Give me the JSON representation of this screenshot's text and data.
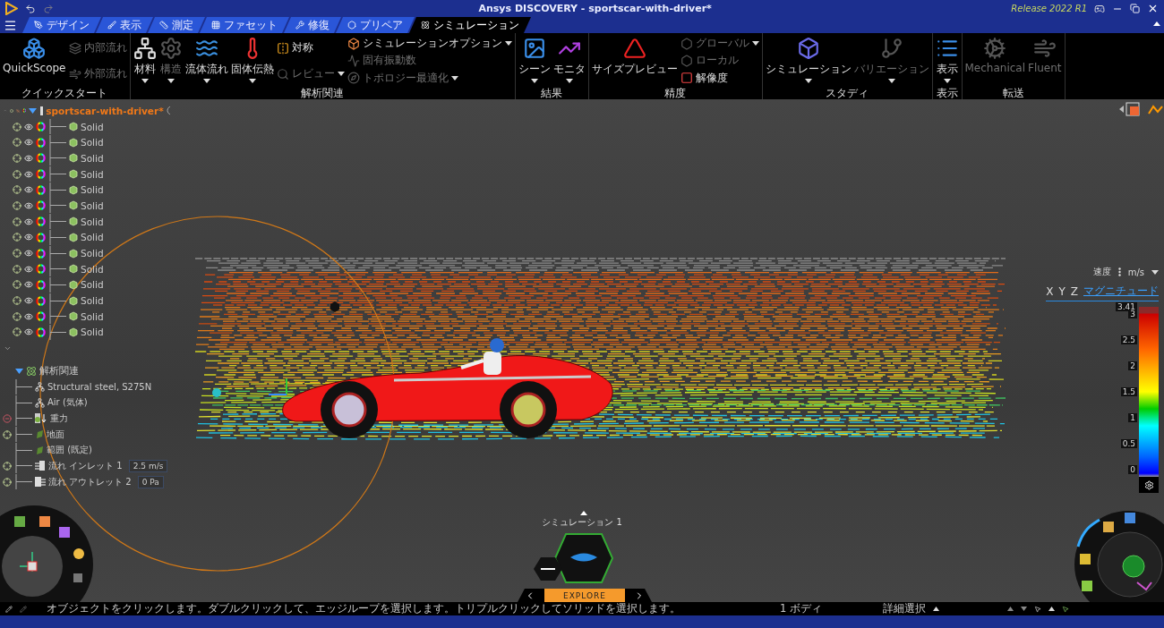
{
  "window": {
    "title": "Ansys DISCOVERY - sportscar-with-driver*",
    "release": "Release 2022 R1"
  },
  "tabs": [
    {
      "label": "デザイン",
      "selected": false
    },
    {
      "label": "表示",
      "selected": false
    },
    {
      "label": "測定",
      "selected": false
    },
    {
      "label": "ファセット",
      "selected": false
    },
    {
      "label": "修復",
      "selected": false
    },
    {
      "label": "プリペア",
      "selected": false
    },
    {
      "label": "シミュレーション",
      "selected": true
    }
  ],
  "ribbon": {
    "groups": [
      {
        "label": "クイックスタート",
        "columns": [
          {
            "items": [
              {
                "label": "QuickScope",
                "kind": "large",
                "disabled": false,
                "dropdown": false
              }
            ]
          },
          {
            "items": [
              {
                "label": "内部流れ",
                "kind": "small",
                "disabled": true,
                "dropdown": false
              },
              {
                "label": "外部流れ",
                "kind": "small",
                "disabled": true,
                "dropdown": false
              }
            ]
          }
        ]
      },
      {
        "label": "解析関連",
        "columns": [
          {
            "items": [
              {
                "label": "材料",
                "kind": "large",
                "disabled": false,
                "dropdown": true
              }
            ]
          },
          {
            "items": [
              {
                "label": "構造",
                "kind": "large",
                "disabled": true,
                "dropdown": true
              }
            ]
          },
          {
            "items": [
              {
                "label": "流体流れ",
                "kind": "large",
                "disabled": false,
                "dropdown": true
              }
            ]
          },
          {
            "items": [
              {
                "label": "固体伝熱",
                "kind": "large",
                "disabled": false,
                "dropdown": true
              }
            ]
          },
          {
            "items": [
              {
                "label": "対称",
                "kind": "small",
                "disabled": false,
                "dropdown": false
              },
              {
                "label": "レビュー",
                "kind": "small",
                "disabled": true,
                "dropdown": true
              }
            ]
          },
          {
            "items": [
              {
                "label": "シミュレーションオプション",
                "kind": "small",
                "disabled": false,
                "dropdown": true
              },
              {
                "label": "固有振動数",
                "kind": "small",
                "disabled": true,
                "dropdown": false
              },
              {
                "label": "トポロジー最適化",
                "kind": "small",
                "disabled": true,
                "dropdown": true
              }
            ]
          }
        ]
      },
      {
        "label": "結果",
        "columns": [
          {
            "items": [
              {
                "label": "シーン",
                "kind": "large",
                "disabled": false,
                "dropdown": true
              }
            ]
          },
          {
            "items": [
              {
                "label": "モニタ",
                "kind": "large",
                "disabled": false,
                "dropdown": true
              }
            ]
          }
        ]
      },
      {
        "label": "精度",
        "columns": [
          {
            "items": [
              {
                "label": "サイズプレビュー",
                "kind": "large",
                "disabled": false,
                "dropdown": false
              }
            ]
          },
          {
            "items": [
              {
                "label": "グローバル",
                "kind": "small",
                "disabled": true,
                "dropdown": true
              },
              {
                "label": "ローカル",
                "kind": "small",
                "disabled": true,
                "dropdown": false
              },
              {
                "label": "解像度",
                "kind": "small",
                "disabled": false,
                "dropdown": false
              }
            ]
          }
        ]
      },
      {
        "label": "スタディ",
        "columns": [
          {
            "items": [
              {
                "label": "シミュレーション",
                "kind": "large",
                "disabled": false,
                "dropdown": true
              }
            ]
          },
          {
            "items": [
              {
                "label": "バリエーション",
                "kind": "large",
                "disabled": true,
                "dropdown": true
              }
            ]
          }
        ]
      },
      {
        "label": "表示",
        "columns": [
          {
            "items": [
              {
                "label": "表示",
                "kind": "large",
                "disabled": false,
                "dropdown": true
              }
            ]
          }
        ]
      },
      {
        "label": "転送",
        "columns": [
          {
            "items": [
              {
                "label": "Mechanical",
                "kind": "large",
                "disabled": true,
                "dropdown": false
              }
            ]
          },
          {
            "items": [
              {
                "label": "Fluent",
                "kind": "large",
                "disabled": true,
                "dropdown": false
              }
            ]
          }
        ]
      }
    ]
  },
  "structure_tree": {
    "label": "sportscar-with-driver*",
    "expanded": true,
    "children": [
      {
        "label": "Solid"
      },
      {
        "label": "Solid"
      },
      {
        "label": "Solid"
      },
      {
        "label": "Solid"
      },
      {
        "label": "Solid"
      },
      {
        "label": "Solid"
      },
      {
        "label": "Solid"
      },
      {
        "label": "Solid"
      },
      {
        "label": "Solid"
      },
      {
        "label": "Solid"
      },
      {
        "label": "Solid"
      },
      {
        "label": "Solid"
      },
      {
        "label": "Solid"
      },
      {
        "label": "Solid"
      }
    ]
  },
  "analysis_tree": {
    "label": "解析関連",
    "expanded": true,
    "children": [
      {
        "label": "Structural steel, S275N",
        "kind": "material",
        "target": false
      },
      {
        "label": "Air (気体)",
        "kind": "material",
        "target": false
      },
      {
        "label": "重力",
        "kind": "gravity",
        "target": true,
        "suppressed": true
      },
      {
        "label": "地面",
        "kind": "surface",
        "target": true,
        "suppressed": false
      },
      {
        "label": "範囲 (既定)",
        "kind": "surface",
        "target": false
      },
      {
        "label": "流れ インレット 1",
        "kind": "inlet",
        "target": true,
        "suppressed": false,
        "value": "2.5 m/s"
      },
      {
        "label": "流れ アウトレット 2",
        "kind": "outlet",
        "target": true,
        "suppressed": false,
        "value": "0 Pa"
      }
    ]
  },
  "legend": {
    "quantity": "速度",
    "unit": "m/s",
    "components": [
      {
        "label": "X",
        "selected": false
      },
      {
        "label": "Y",
        "selected": false
      },
      {
        "label": "Z",
        "selected": false
      },
      {
        "label": "マグニチュード",
        "selected": true
      }
    ],
    "max": "3.41",
    "ticks": [
      "3",
      "2.5",
      "2",
      "1.5",
      "1",
      "0.5",
      "0"
    ]
  },
  "stage": {
    "label": "シミュレーション 1",
    "mode": "EXPLORE"
  },
  "status_bar": {
    "hint": "オブジェクトをクリックします。ダブルクリックして、エッジループを選択します。トリプルクリックしてソリッドを選択します。",
    "bodies": "1 ボディ",
    "selection": "詳細選択"
  }
}
